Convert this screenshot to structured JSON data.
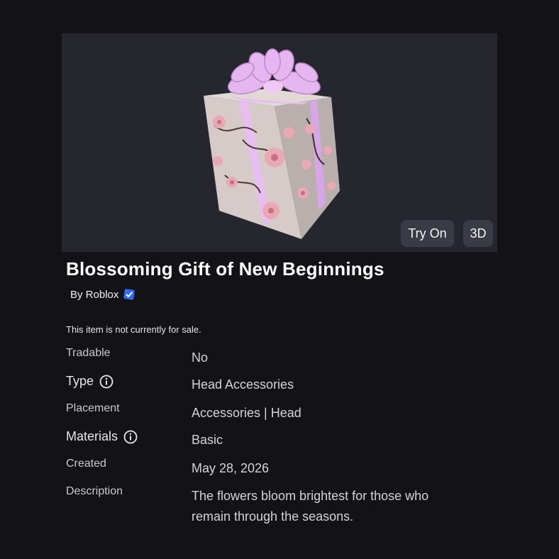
{
  "viewer": {
    "try_on_label": "Try On",
    "three_d_label": "3D"
  },
  "item": {
    "title": "Blossoming Gift of New Beginnings",
    "creator": "By Roblox",
    "sale_note": "This item is not currently for sale."
  },
  "details": [
    {
      "label": "Tradable",
      "value": "No",
      "info_icon": false
    },
    {
      "label": "Type",
      "value": "Head Accessories",
      "info_icon": true
    },
    {
      "label": "Placement",
      "value": "Accessories | Head",
      "info_icon": false
    },
    {
      "label": "Materials",
      "value": "Basic",
      "info_icon": true
    },
    {
      "label": "Created",
      "value": "May 28, 2026",
      "info_icon": false
    },
    {
      "label": "Description",
      "value": "The flowers bloom brightest for those who remain through the seasons.",
      "info_icon": false
    }
  ],
  "colors": {
    "background": "#131317",
    "viewer_bg": "#26262f",
    "button_bg": "#393b45",
    "verified_badge": "#2f6df6",
    "gift_wrap": "#d9cfcc",
    "ribbon": "#e6b6f0"
  },
  "icons": {
    "verified": "verified-badge-icon",
    "info": "info-icon"
  }
}
